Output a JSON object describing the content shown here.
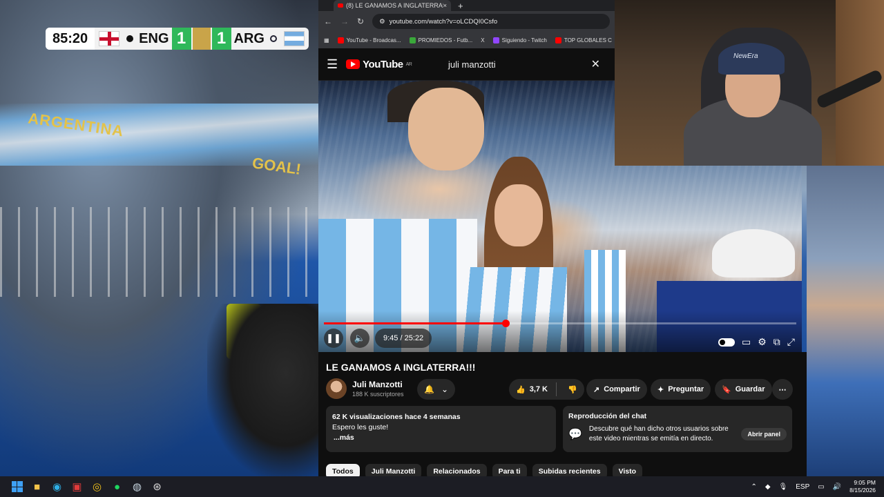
{
  "scoreboard": {
    "time": "85:20",
    "home_team": "ENG",
    "home_score": "1",
    "away_score": "1",
    "away_team": "ARG"
  },
  "stadium": {
    "banner_text": "ARGENTINA",
    "goal_text": "GOAL!"
  },
  "browser": {
    "tab_title": "(8) LE GANAMOS A INGLATERRA!!!",
    "tab_close": "×",
    "new_tab": "+",
    "url": "youtube.com/watch?v=oLCDQI0Csfo",
    "bookmarks": [
      {
        "label": "YouTube - Broadcas...",
        "color": "#ff0000"
      },
      {
        "label": "PROMIEDOS - Futb...",
        "color": "#3aa83a"
      },
      {
        "label": "X",
        "color": "#000000"
      },
      {
        "label": "Siguiendo - Twitch",
        "color": "#9146ff"
      },
      {
        "label": "TOP GLOBALES C",
        "color": "#ff0000"
      }
    ]
  },
  "youtube": {
    "logo_text": "YouTube",
    "region": "AR",
    "search_value": "juli manzotti",
    "video": {
      "current_time": "9:45",
      "duration": "25:22",
      "progress": 0.385
    },
    "title": "LE GANAMOS A INGLATERRA!!!",
    "channel_name": "Juli Manzotti",
    "subscribers": "188 K suscriptores",
    "likes": "3,7 K",
    "share_label": "Compartir",
    "ask_label": "Preguntar",
    "save_label": "Guardar",
    "views_line": "62 K visualizaciones  hace 4 semanas",
    "description": "Espero les guste!",
    "more": "...más",
    "chat": {
      "title": "Reproducción del chat",
      "message": "Descubre qué han dicho otros usuarios sobre este video mientras se emitía en directo.",
      "button": "Abrir panel"
    },
    "chips": [
      "Todos",
      "Juli Manzotti",
      "Relacionados",
      "Para ti",
      "Subidas recientes",
      "Visto"
    ]
  },
  "webcam": {
    "cap_text": "NewEra"
  },
  "taskbar": {
    "lang": "ESP",
    "time": "9:05 PM",
    "date": "8/15/2026"
  }
}
